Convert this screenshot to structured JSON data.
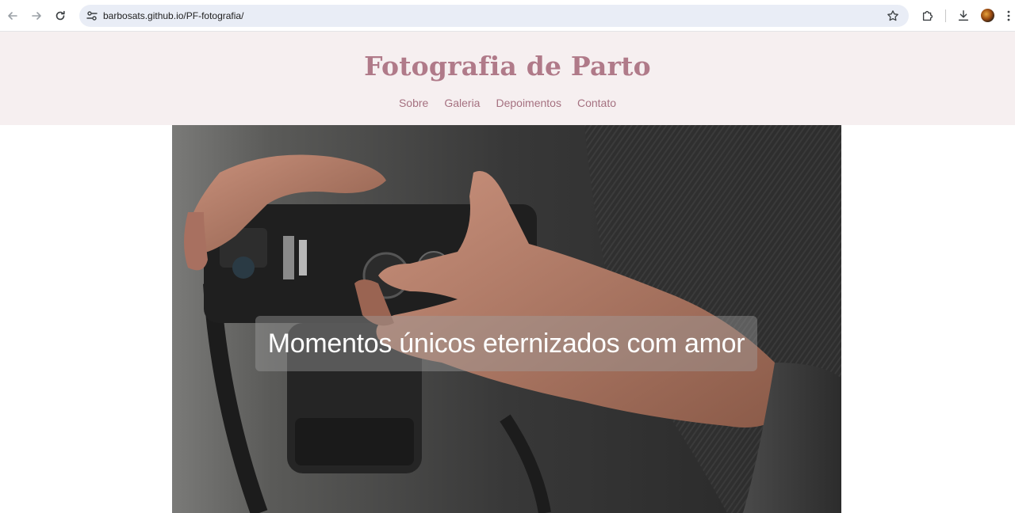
{
  "browser": {
    "url": "barbosats.github.io/PF-fotografia/",
    "icons": {
      "back": "arrow-left-icon",
      "forward": "arrow-right-icon",
      "reload": "reload-icon",
      "site_info": "tune-icon",
      "bookmark": "star-icon",
      "extensions": "puzzle-icon",
      "downloads": "download-icon",
      "profile": "avatar",
      "menu": "kebab-menu-icon"
    }
  },
  "site": {
    "title": "Fotografia de Parto",
    "nav": [
      "Sobre",
      "Galeria",
      "Depoimentos",
      "Contato"
    ],
    "colors": {
      "header_bg": "#f6eff0",
      "title": "#b07a89",
      "nav_link": "#a57180"
    }
  },
  "hero": {
    "caption": "Momentos únicos eternizados com amor"
  }
}
